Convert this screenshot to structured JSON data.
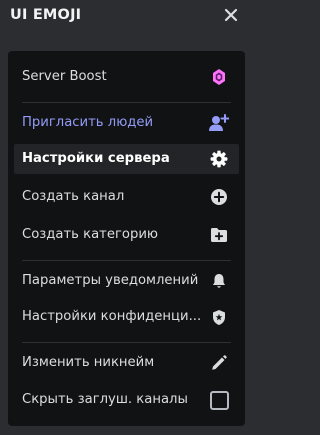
{
  "header": {
    "server_name": "UI EMOJI",
    "close_icon": "close-icon"
  },
  "menu": {
    "items": [
      {
        "label": "Server Boost",
        "icon": "boost-gem-icon"
      },
      {
        "label": "Пригласить людей",
        "icon": "add-person-icon",
        "color": "#949cf7"
      },
      {
        "label": "Настройки сервера",
        "icon": "gear-icon"
      },
      {
        "label": "Создать канал",
        "icon": "plus-circle-icon"
      },
      {
        "label": "Создать категорию",
        "icon": "folder-plus-icon"
      },
      {
        "label": "Параметры уведомлений",
        "icon": "bell-icon"
      },
      {
        "label": "Настройки конфиденци...",
        "icon": "shield-icon"
      },
      {
        "label": "Изменить никнейм",
        "icon": "pencil-icon"
      },
      {
        "label": "Скрыть заглуш. каналы",
        "icon": "checkbox-icon",
        "checked": false
      }
    ]
  },
  "colors": {
    "background": "#2b2d31",
    "menu_background": "#111214",
    "accent": "#949cf7",
    "boost": "#ff73fa",
    "text": "#dbdee1"
  }
}
